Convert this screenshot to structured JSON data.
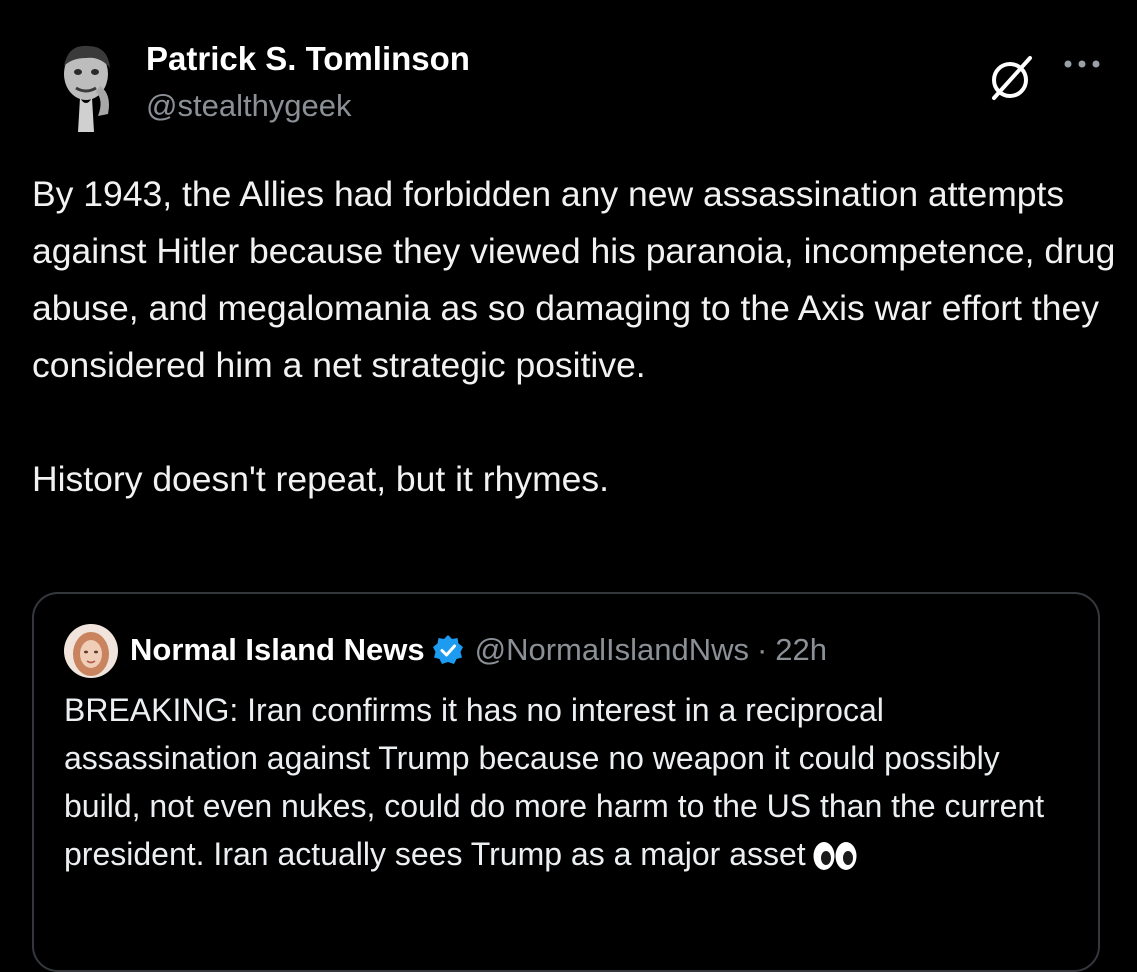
{
  "author": {
    "name": "Patrick S. Tomlinson",
    "handle": "@stealthygeek"
  },
  "icons": {
    "grok": "grok-icon",
    "more": "more-options-icon",
    "verified": "verified-badge-icon",
    "eyes": "eyes-emoji-icon"
  },
  "post": {
    "text": "By 1943, the Allies had forbidden any new assassination attempts against Hitler because they viewed his paranoia, incompetence, drug abuse, and megalomania as so damaging to the Axis war effort they considered him a net strategic positive.\n\nHistory doesn't repeat, but it rhymes."
  },
  "quoted_post": {
    "name": "Normal Island News",
    "handle": "@NormalIslandNws",
    "separator": "·",
    "time": "22h",
    "text": "BREAKING: Iran confirms it has no interest in a reciprocal assassination against Trump because no weapon it could possibly build, not even nukes, could do more harm to the US than the current president. Iran actually sees Trump as a major asset"
  },
  "colors": {
    "background": "#000000",
    "text_primary": "#e7e9ea",
    "text_secondary": "#8b9096",
    "border": "#34383d",
    "verified": "#1d9bf0"
  }
}
